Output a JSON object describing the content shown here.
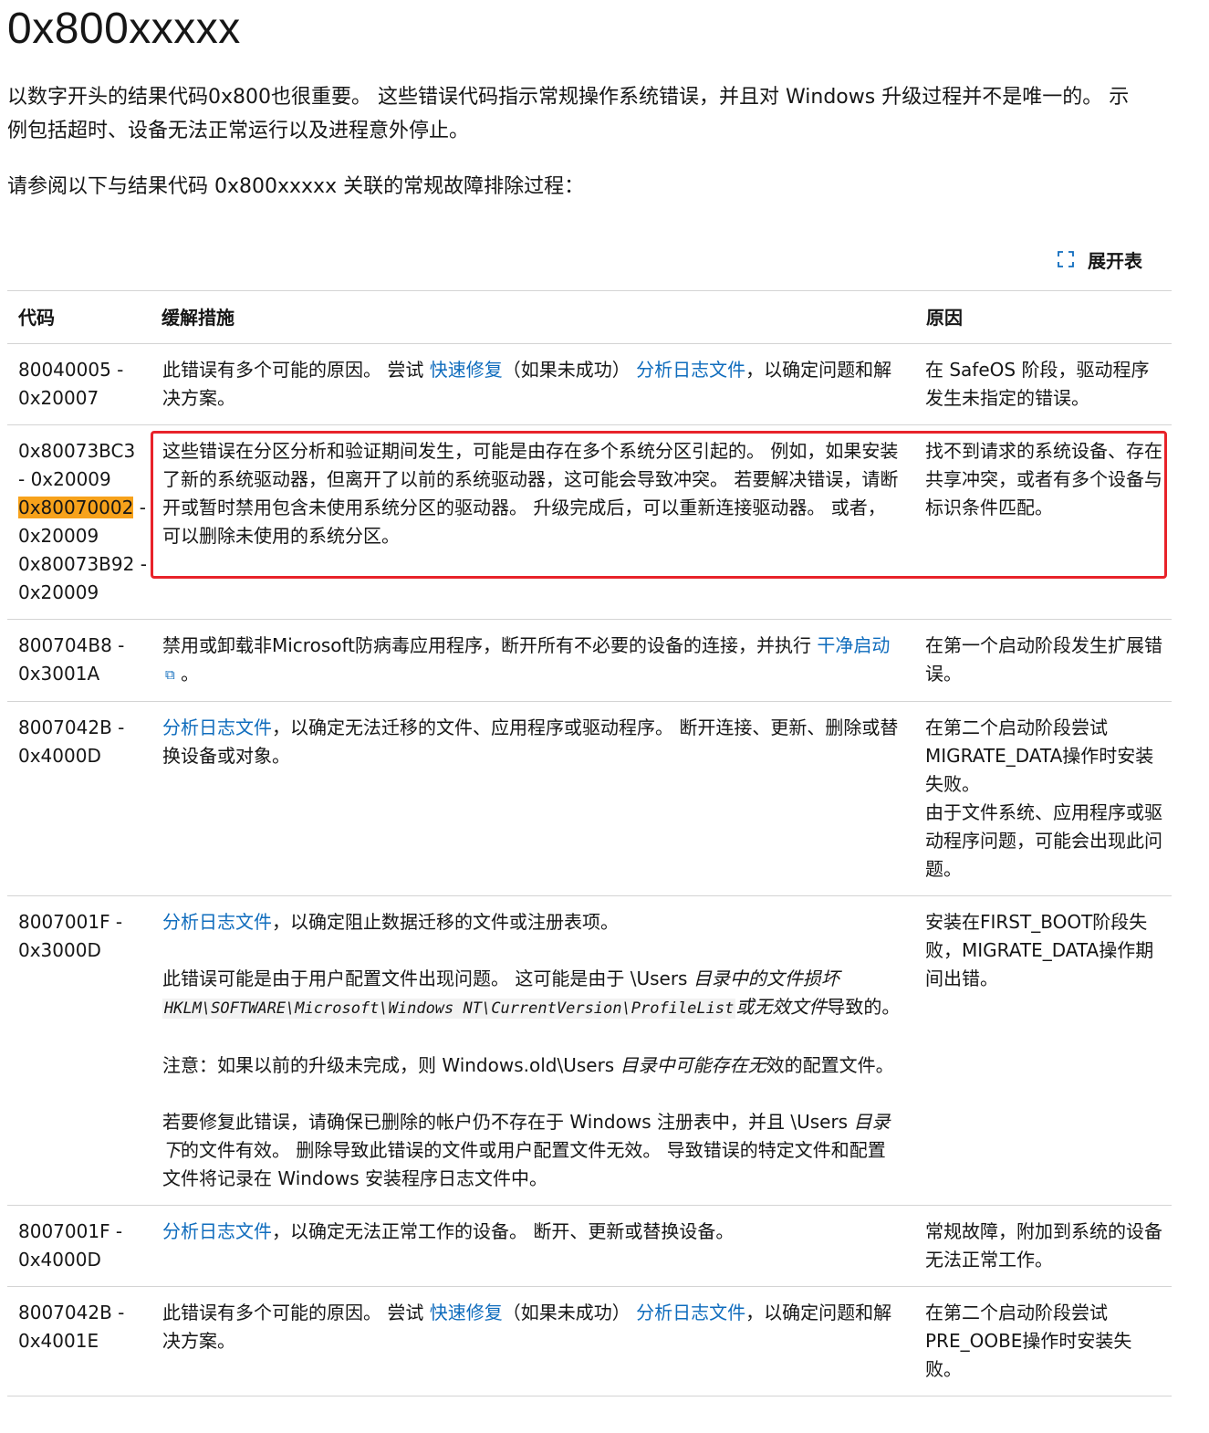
{
  "title": "0x800xxxxx",
  "intro": "以数字开头的结果代码0x800也很重要。 这些错误代码指示常规操作系统错误，并且对 Windows 升级过程并不是唯一的。 示例包括超时、设备无法正常运行以及进程意外停止。",
  "intro2": "请参阅以下与结果代码 0x800xxxxx 关联的常规故障排除过程：",
  "expand_label": "展开表",
  "table": {
    "headers": {
      "code": "代码",
      "mitigation": "缓解措施",
      "cause": "原因"
    },
    "rows": [
      {
        "code": "80040005 - 0x20007",
        "mit_pre": "此错误有多个可能的原因。 尝试 ",
        "mit_link1": "快速修复",
        "mit_mid": "（如果未成功）",
        "mit_link2": "分析日志文件",
        "mit_post": "，以确定问题和解决方案。",
        "cause": "在 SafeOS 阶段，驱动程序发生未指定的错误。"
      },
      {
        "code_a": "0x80073BC3 - 0x20009",
        "code_b_hl": "0x80070002",
        "code_b_rest": " - 0x20009",
        "code_c": "0x80073B92 - 0x20009",
        "mitigation": "这些错误在分区分析和验证期间发生，可能是由存在多个系统分区引起的。 例如，如果安装了新的系统驱动器，但离开了以前的系统驱动器，这可能会导致冲突。 若要解决错误，请断开或暂时禁用包含未使用系统分区的驱动器。 升级完成后，可以重新连接驱动器。 或者，可以删除未使用的系统分区。",
        "cause": "找不到请求的系统设备、存在共享冲突，或者有多个设备与标识条件匹配。"
      },
      {
        "code": "800704B8 - 0x3001A",
        "mit_pre": "禁用或卸载非Microsoft防病毒应用程序，断开所有不必要的设备的连接，并执行 ",
        "mit_link": "干净启动",
        "mit_post": "。",
        "cause": "在第一个启动阶段发生扩展错误。"
      },
      {
        "code": "8007042B - 0x4000D",
        "mit_link": "分析日志文件",
        "mit_post": "，以确定无法迁移的文件、应用程序或驱动程序。 断开连接、更新、删除或替换设备或对象。",
        "cause_a": "在第二个启动阶段尝试 MIGRATE_DATA操作时安装失败。",
        "cause_b": "由于文件系统、应用程序或驱动程序问题，可能会出现此问题。"
      },
      {
        "code": "8007001F - 0x3000D",
        "mit_link": "分析日志文件",
        "mit_p1_post": "，以确定阻止数据迁移的文件或注册表项。",
        "mit_p2_pre": "此错误可能是由于用户配置文件出现问题。 这可能是由于 \\Users ",
        "mit_p2_em": "目录中的文件损坏",
        "mit_p2_code": "HKLM\\SOFTWARE\\Microsoft\\Windows NT\\CurrentVersion\\ProfileList",
        "mit_p2_em2": "或无效文件",
        "mit_p2_post": "导致的。",
        "mit_p3_pre": "注意：如果以前的升级未完成，则 Windows.old\\Users ",
        "mit_p3_em": "目录中可能存在无",
        "mit_p3_post": "效的配置文件。",
        "mit_p4_pre": "若要修复此错误，请确保已删除的帐户仍不存在于 Windows 注册表中，并且 \\Users ",
        "mit_p4_em": "目录下",
        "mit_p4_post": "的文件有效。 删除导致此错误的文件或用户配置文件无效。 导致错误的特定文件和配置文件将记录在 Windows 安装程序日志文件中。",
        "cause": "安装在FIRST_BOOT阶段失败，MIGRATE_DATA操作期间出错。"
      },
      {
        "code": "8007001F - 0x4000D",
        "mit_link": "分析日志文件",
        "mit_post": "，以确定无法正常工作的设备。 断开、更新或替换设备。",
        "cause": "常规故障，附加到系统的设备无法正常工作。"
      },
      {
        "code": "8007042B - 0x4001E",
        "mit_pre": "此错误有多个可能的原因。 尝试 ",
        "mit_link1": "快速修复",
        "mit_mid": "（如果未成功）",
        "mit_link2": "分析日志文件",
        "mit_post": "，以确定问题和解决方案。",
        "cause": "在第二个启动阶段尝试 PRE_OOBE操作时安装失败。"
      }
    ]
  }
}
